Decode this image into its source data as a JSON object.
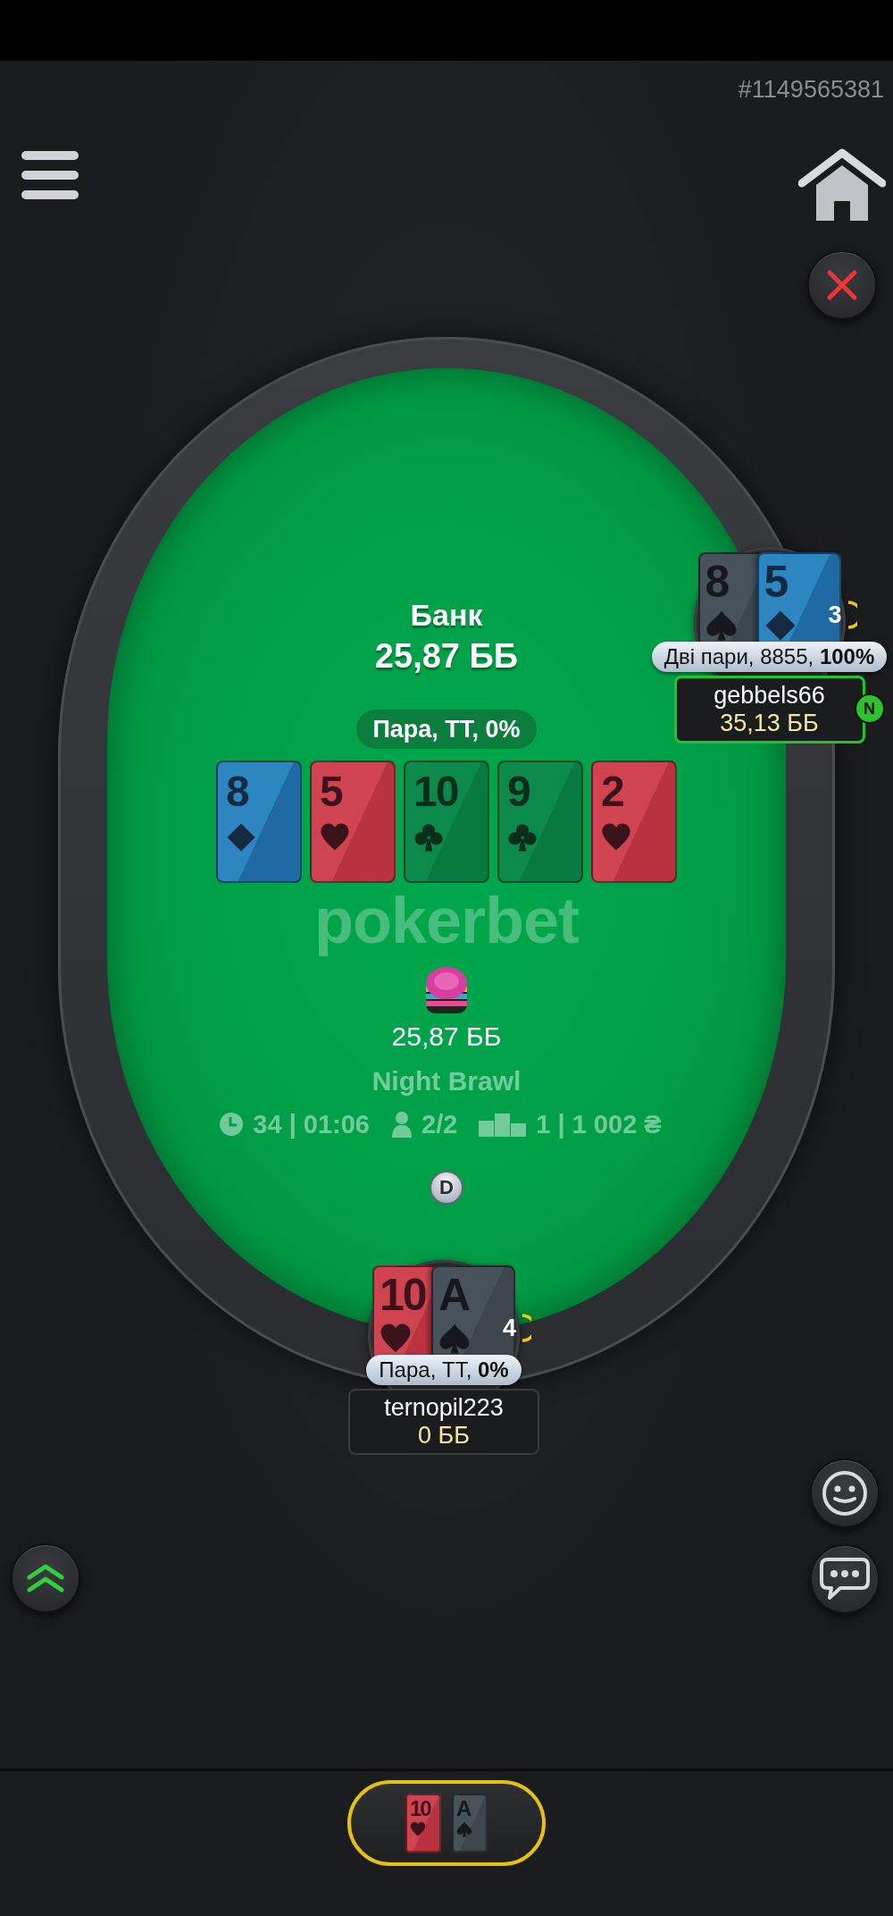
{
  "hand_id": "#1149565381",
  "pot": {
    "label": "Банк",
    "amount": "25,87 ББ"
  },
  "board_hand": "Пара, ТТ, 0%",
  "board": [
    {
      "rank": "8",
      "kind": "diamonds"
    },
    {
      "rank": "5",
      "kind": "hearts"
    },
    {
      "rank": "10",
      "kind": "clubs"
    },
    {
      "rank": "9",
      "kind": "clubs"
    },
    {
      "rank": "2",
      "kind": "hearts"
    }
  ],
  "table_logo": "pokerbet",
  "bet": {
    "amount": "25,87 ББ"
  },
  "tournament": {
    "name": "Night Brawl",
    "level": "34 | 01:06",
    "players": "2/2",
    "prize": "1 | 1 002 ₴"
  },
  "dealer_button": "D",
  "players": [
    {
      "name": "gebbels66",
      "stack": "35,13 ББ",
      "hand": "Дві пари, 8855, **100%**",
      "timer": "3",
      "active": true,
      "badge": "N",
      "cards": [
        {
          "rank": "8",
          "kind": "spades"
        },
        {
          "rank": "5",
          "kind": "diamonds"
        }
      ]
    },
    {
      "name": "ternopil223",
      "stack": "0 ББ",
      "hand": "Пара, ТТ, **0%**",
      "timer": "4",
      "active": false,
      "cards": [
        {
          "rank": "10",
          "kind": "hearts"
        },
        {
          "rank": "A",
          "kind": "spades"
        }
      ]
    }
  ],
  "my_cards": [
    {
      "rank": "10",
      "kind": "hearts"
    },
    {
      "rank": "A",
      "kind": "spades"
    }
  ]
}
